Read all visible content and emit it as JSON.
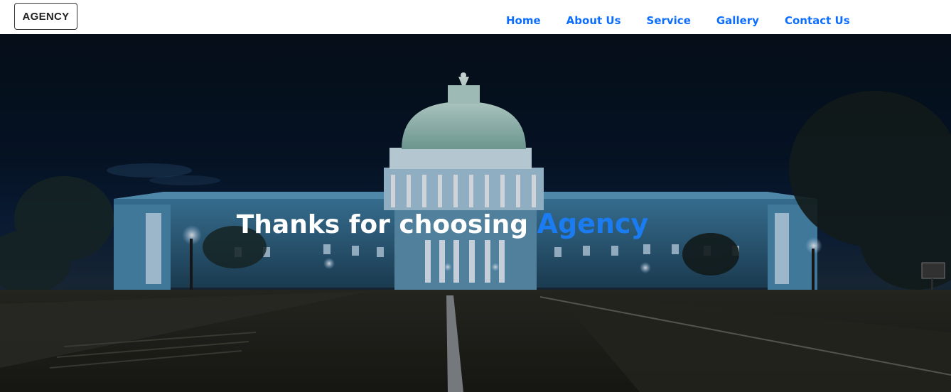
{
  "navbar": {
    "brand": "AGENCY",
    "links": [
      {
        "label": "Home"
      },
      {
        "label": "About Us"
      },
      {
        "label": "Service"
      },
      {
        "label": "Gallery"
      },
      {
        "label": "Contact Us"
      }
    ]
  },
  "hero": {
    "title_prefix": "Thanks for choosing ",
    "title_accent": "Agency",
    "background_image": "capitol-building-at-night",
    "accent_color": "#1b7cf2"
  },
  "colors": {
    "nav_link": "#0d6efd",
    "brand_text": "#222222",
    "hero_text": "#ffffff"
  }
}
